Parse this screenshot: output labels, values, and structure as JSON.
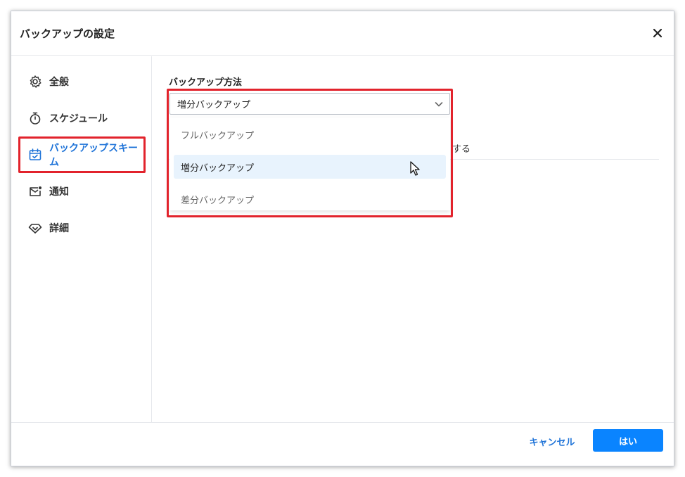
{
  "dialog": {
    "title": "バックアップの設定"
  },
  "sidebar": {
    "items": [
      {
        "label": "全般",
        "icon": "gear-icon"
      },
      {
        "label": "スケジュール",
        "icon": "stopwatch-icon"
      },
      {
        "label": "バックアップスキーム",
        "icon": "calendar-check-icon",
        "active": true
      },
      {
        "label": "通知",
        "icon": "mail-icon"
      },
      {
        "label": "詳細",
        "icon": "diamond-icon"
      }
    ]
  },
  "main": {
    "section_label": "バックアップ方法",
    "method_select": {
      "value": "増分バックアップ"
    },
    "method_options": [
      "フルバックアップ",
      "増分バックアップ",
      "差分バックアップ"
    ],
    "selected_option_index": 1,
    "partial_text": "する"
  },
  "footer": {
    "cancel_label": "キャンセル",
    "ok_label": "はい"
  },
  "colors": {
    "accent": "#1e73d8",
    "primary_button": "#0a84ff",
    "highlight_border": "#e2232c",
    "selected_option_bg": "#e8f3fd"
  }
}
